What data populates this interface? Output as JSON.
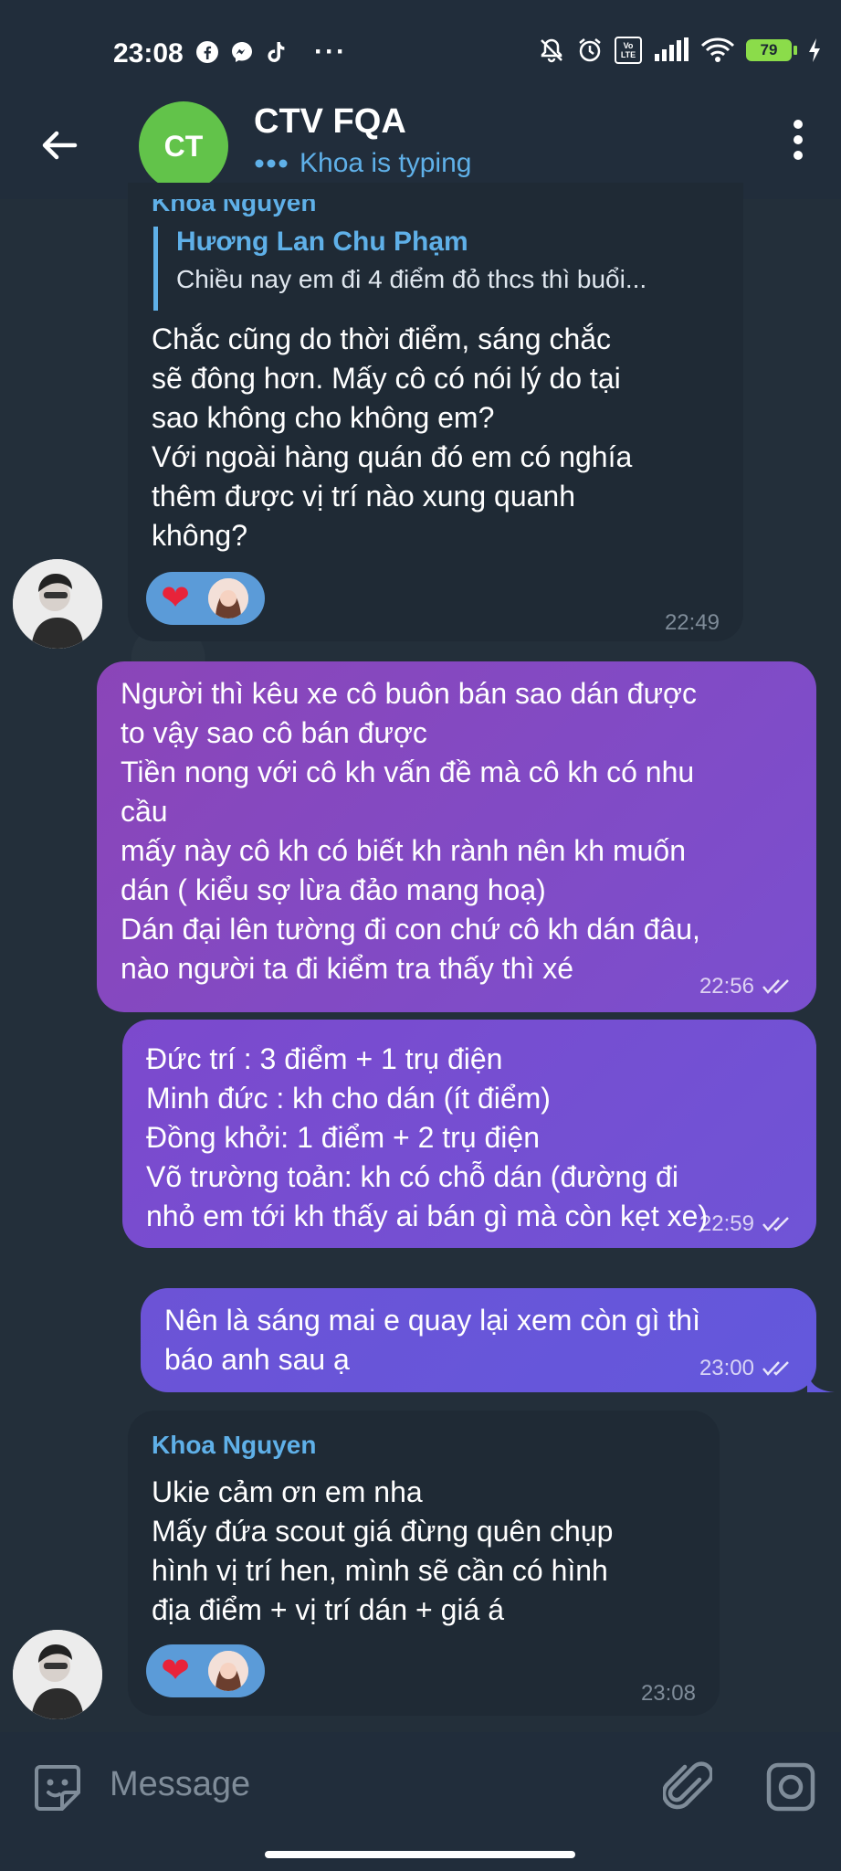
{
  "status_bar": {
    "time": "23:08",
    "dots": "···",
    "battery": "79",
    "volte_label": "Vo LTE"
  },
  "header": {
    "avatar_initials": "CT",
    "title": "CTV FQA",
    "subtitle": "Khoa is typing",
    "accent": "#5fb0e8",
    "avatar_color": "#62c34a"
  },
  "messages": [
    {
      "direction": "in",
      "sender": "Khoa Nguyen",
      "reply_to": {
        "name": "Hương Lan Chu Phạm",
        "text": "Chiều nay em đi 4 điểm đỏ thcs thì buổi..."
      },
      "text": "Chắc cũng do thời điểm, sáng chắc\nsẽ đông hơn. Mấy cô có nói lý do tại\nsao không cho không em?\nVới ngoài hàng quán đó em có nghía\nthêm được vị trí nào xung quanh\nkhông?",
      "time": "22:49",
      "reaction": "heart"
    },
    {
      "direction": "out",
      "text": "Người thì kêu xe cô buôn bán sao dán được\n to vậy sao cô bán được\nTiền nong với cô kh vấn đề mà cô kh có nhu\ncầu\nmấy này cô kh có biết kh rành nên kh muốn\ndán ( kiểu sợ lừa đảo mang hoạ)\nDán đại lên tường đi con chứ cô kh dán đâu,\nnào người ta đi kiểm tra thấy thì xé",
      "time": "22:56"
    },
    {
      "direction": "out",
      "text": "Đức trí : 3 điểm + 1 trụ điện\nMinh đức : kh cho dán (ít điểm)\nĐồng khởi: 1 điểm + 2 trụ điện\nVõ trường toản: kh có chỗ dán (đường đi\nnhỏ em tới kh thấy ai bán gì mà còn kẹt xe)",
      "time": "22:59"
    },
    {
      "direction": "out",
      "text": "Nên là sáng mai e quay lại xem còn gì thì\nbáo anh sau ạ",
      "time": "23:00"
    },
    {
      "direction": "in",
      "sender": "Khoa Nguyen",
      "text": "Ukie cảm ơn em nha\nMấy đứa scout giá đừng quên chụp\nhình vị trí hen, mình sẽ cần có hình\nđịa điểm + vị trí dán + giá á",
      "time": "23:08",
      "reaction": "heart"
    }
  ],
  "input": {
    "placeholder": "Message"
  }
}
